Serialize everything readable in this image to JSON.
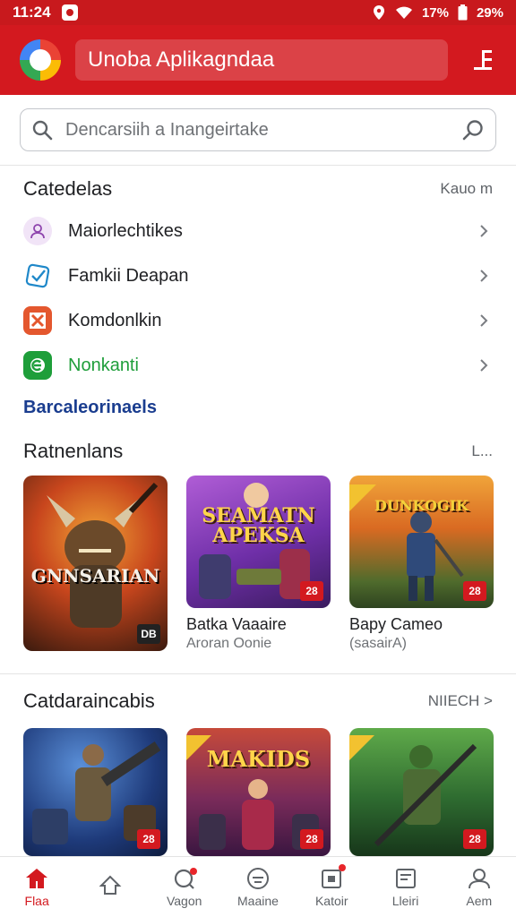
{
  "status": {
    "time": "11:24",
    "battery": "29%",
    "signal": "17%"
  },
  "header": {
    "title": "Unoba Aplikagndaa",
    "logo_icon": "chrome-logo-icon",
    "menu_icon": "menu-icon"
  },
  "search": {
    "placeholder": "Dencarsiih a Inangeirtake"
  },
  "categories": {
    "title": "Catedelas",
    "more": "Kauo m",
    "items": [
      {
        "label": "Maiorlechtikes",
        "icon": "user-icon",
        "color": "#8e44ad"
      },
      {
        "label": "Famkii Deapan",
        "icon": "check-badge-icon",
        "color": "#1f88c9"
      },
      {
        "label": "Komdonlkin",
        "icon": "kickstart-icon",
        "color": "#e4572e"
      },
      {
        "label": "Nonkanti",
        "icon": "shield-e-icon",
        "color": "#1e9e3a"
      }
    ]
  },
  "link": {
    "text": "Barcaleorinaels"
  },
  "recommended": {
    "title": "Ratnenlans",
    "more": "L...",
    "cards": [
      {
        "image_title": "GNNSARIAN",
        "tag": "DB",
        "name": "",
        "sub": ""
      },
      {
        "image_title": "SEAMATN APEKSA",
        "tag": "28",
        "name": "Batka Vaaaire",
        "sub": "Aroran Oonie"
      },
      {
        "image_title": "DUNKOGIK",
        "tag": "28",
        "name": "Bapy Cameo",
        "sub": "(sasairA)"
      }
    ]
  },
  "categories2": {
    "title": "Catdaraincabis",
    "more": "NIIECH >",
    "cards": [
      {
        "image_title": "",
        "tag": "28"
      },
      {
        "image_title": "MAKIDS",
        "tag": "28"
      },
      {
        "image_title": "",
        "tag": "28"
      }
    ]
  },
  "nav": {
    "items": [
      {
        "label": "Flaa",
        "icon": "home-icon",
        "active": true
      },
      {
        "label": "",
        "icon": "share-icon",
        "active": false
      },
      {
        "label": "Vagon",
        "icon": "search-notification-icon",
        "active": false
      },
      {
        "label": "Maaine",
        "icon": "face-icon",
        "active": false
      },
      {
        "label": "Katoir",
        "icon": "calendar-icon",
        "active": false
      },
      {
        "label": "Lleiri",
        "icon": "library-icon",
        "active": false
      },
      {
        "label": "Aem",
        "icon": "account-icon",
        "active": false
      }
    ]
  }
}
